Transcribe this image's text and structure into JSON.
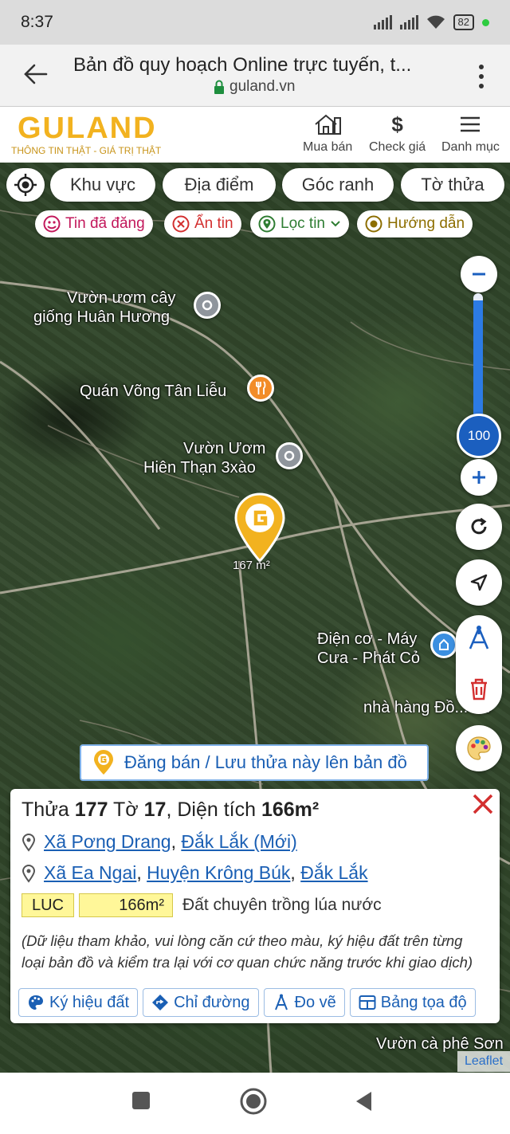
{
  "status_bar": {
    "time": "8:37",
    "battery": "82"
  },
  "browser": {
    "title": "Bản đồ quy hoạch Online trực tuyến, t...",
    "url": "guland.vn"
  },
  "site_header": {
    "logo_text": "GULAND",
    "tagline": "THÔNG TIN THẬT - GIÁ TRỊ THẬT",
    "nav": [
      {
        "label": "Mua bán",
        "icon": "house-icon"
      },
      {
        "label": "Check giá",
        "icon": "dollar-icon"
      },
      {
        "label": "Danh mục",
        "icon": "hamburger-icon"
      }
    ]
  },
  "filters": [
    "Khu vực",
    "Địa điểm",
    "Góc ranh",
    "Tờ thửa"
  ],
  "chips": [
    {
      "label": "Tin đã đăng",
      "color": "#c2185b"
    },
    {
      "label": "Ẩn tin",
      "color": "#d32f2f"
    },
    {
      "label": "Lọc tin",
      "color": "#2e7d32"
    },
    {
      "label": "Hướng dẫn",
      "color": "#8d6e00"
    }
  ],
  "map": {
    "labels": [
      {
        "id": "vuon-uom-huan-huong",
        "text_line1": "Vườn ươm cây",
        "text_line2": "giống Huân Hương"
      },
      {
        "id": "quan-vong",
        "text": "Quán Võng Tân Liễu"
      },
      {
        "id": "vuon-uom-hien-than",
        "text_line1": "Vườn Ươm",
        "text_line2": "Hiên Thạn 3xào"
      },
      {
        "id": "dien-co",
        "text_line1": "Điện cơ - Máy",
        "text_line2": "Cưa - Phát Cỏ"
      },
      {
        "id": "nha-hang",
        "text": "nhà hàng Đồ... nh"
      },
      {
        "id": "vuon-ca-phe",
        "text": "Vườn cà phê Sơn"
      }
    ],
    "marker_area": "167 m²",
    "zoom_level": "100",
    "zoom_fraction": 0.95,
    "post_banner": "Đăng bán / Lưu thửa này lên bản đồ",
    "attribution": "Leaflet"
  },
  "parcel": {
    "thua_label": "Thửa",
    "thua": "177",
    "to_label": "Tờ",
    "to": "17",
    "area_label": ", Diện tích",
    "area": "166m²",
    "address_new": [
      "Xã Pơng Drang",
      "Đắk Lắk (Mới)"
    ],
    "address_old": [
      "Xã Ea Ngai",
      "Huyện Krông Búk",
      "Đắk Lắk"
    ],
    "land_code": "LUC",
    "land_area": "166m²",
    "land_desc": "Đất chuyên trồng lúa nước",
    "note": "(Dữ liệu tham khảo, vui lòng căn cứ theo màu, ký hiệu đất trên từng loại bản đồ và kiểm tra lại với cơ quan chức năng trước khi giao dịch)",
    "actions": [
      "Ký hiệu đất",
      "Chỉ đường",
      "Đo vẽ",
      "Bảng tọa độ"
    ]
  },
  "colors": {
    "brand": "#f2b21f",
    "link": "#1a5fb4",
    "zoom": "#2c7be5",
    "close": "#d32f2f"
  }
}
